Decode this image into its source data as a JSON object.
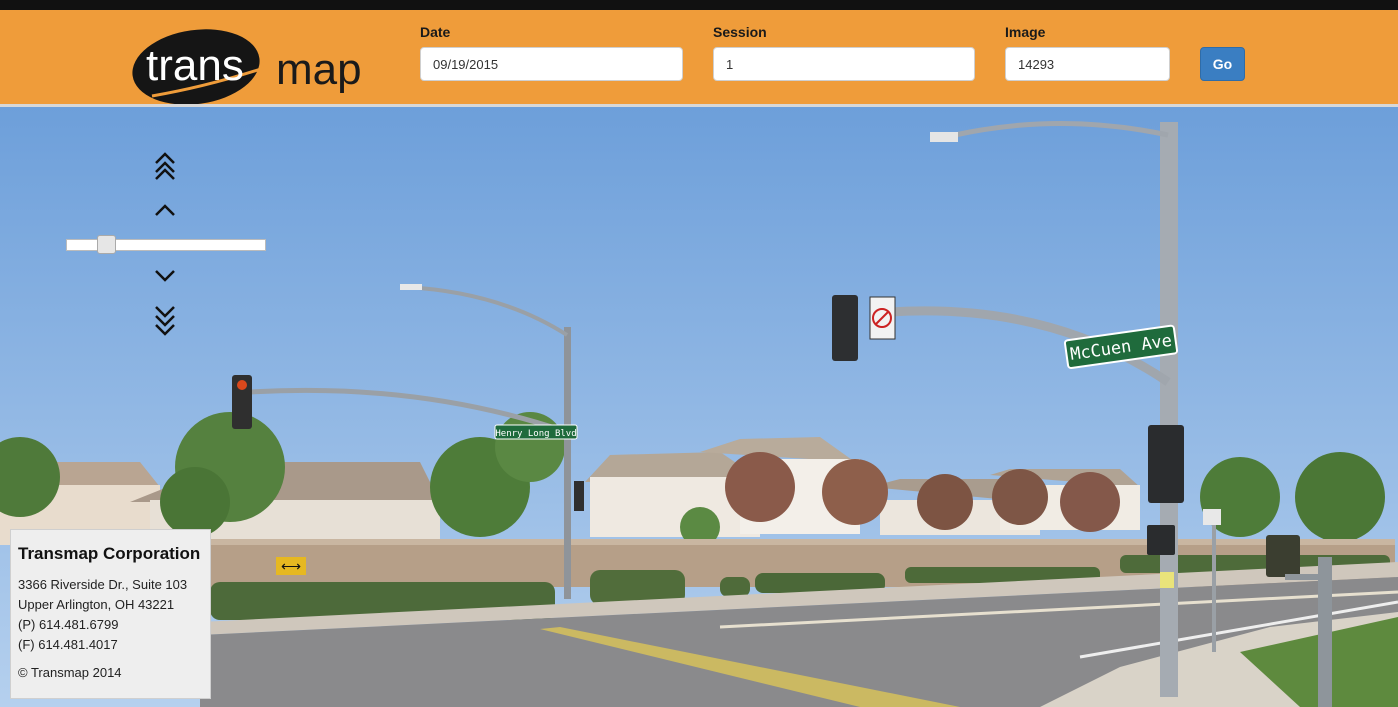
{
  "brand": {
    "logo_text_left": "trans",
    "logo_text_right": "map"
  },
  "search": {
    "date_label": "Date",
    "date_value": "09/19/2015",
    "session_label": "Session",
    "session_value": "1",
    "image_label": "Image",
    "image_value": "14293",
    "go_label": "Go"
  },
  "nav": {
    "icons": [
      "double-chevron-up-icon",
      "chevron-up-icon",
      "chevron-down-icon",
      "double-chevron-down-icon"
    ],
    "slider_level": 0.2
  },
  "street_signs": {
    "sign_1": "Henry Long Blvd",
    "sign_2": "McCuen Ave"
  },
  "company": {
    "name": "Transmap Corporation",
    "address_line1": "3366 Riverside Dr., Suite 103",
    "address_line2": "Upper Arlington, OH 43221",
    "phone": "(P) 614.481.6799",
    "fax": "(F) 614.481.4017",
    "copyright": "© Transmap 2014"
  },
  "colors": {
    "header": "#ef9c3a",
    "button": "#3a7ec2",
    "sky": "#87b3e6"
  }
}
